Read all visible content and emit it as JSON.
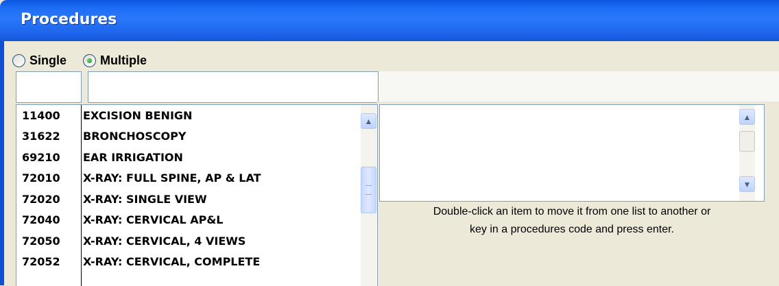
{
  "window": {
    "title": "Procedures"
  },
  "mode": {
    "options": [
      "Single",
      "Multiple"
    ],
    "selected": "Multiple"
  },
  "search": {
    "code_value": "",
    "description_value": ""
  },
  "procedures": [
    {
      "code": "11400",
      "description": "EXCISION BENIGN"
    },
    {
      "code": "31622",
      "description": "BRONCHOSCOPY"
    },
    {
      "code": "69210",
      "description": "EAR IRRIGATION"
    },
    {
      "code": "72010",
      "description": "X-RAY: FULL SPINE, AP & LAT"
    },
    {
      "code": "72020",
      "description": "X-RAY: SINGLE VIEW"
    },
    {
      "code": "72040",
      "description": "X-RAY: CERVICAL AP&L"
    },
    {
      "code": "72050",
      "description": "X-RAY: CERVICAL, 4 VIEWS"
    },
    {
      "code": "72052",
      "description": "X-RAY: CERVICAL, COMPLETE"
    }
  ],
  "selected_procedures": [],
  "help_text": [
    "Double-click an item to move it from one list to another or",
    "key in a procedures code and press enter."
  ],
  "icons": {
    "scroll_up": "chevron-up-icon",
    "scroll_down": "chevron-down-icon",
    "grip": "scroll-grip-icon"
  }
}
